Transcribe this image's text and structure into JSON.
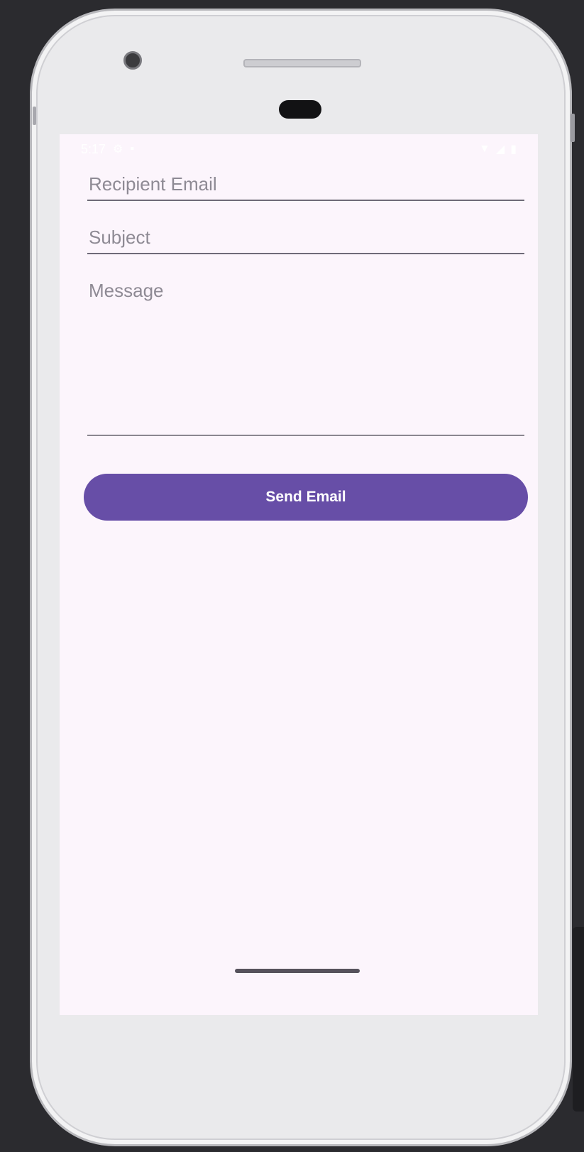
{
  "status_bar": {
    "time": "5:17",
    "icons_left": [
      "settings-icon",
      "notification-icon"
    ],
    "icons_right": [
      "wifi-icon",
      "signal-icon",
      "battery-icon"
    ]
  },
  "form": {
    "recipient": {
      "placeholder": "Recipient Email",
      "value": ""
    },
    "subject": {
      "placeholder": "Subject",
      "value": ""
    },
    "message": {
      "placeholder": "Message",
      "value": ""
    },
    "send_label": "Send Email"
  },
  "colors": {
    "accent": "#674ea7",
    "screen_background": "#fcf5fc",
    "underline": "#6e6a78"
  }
}
